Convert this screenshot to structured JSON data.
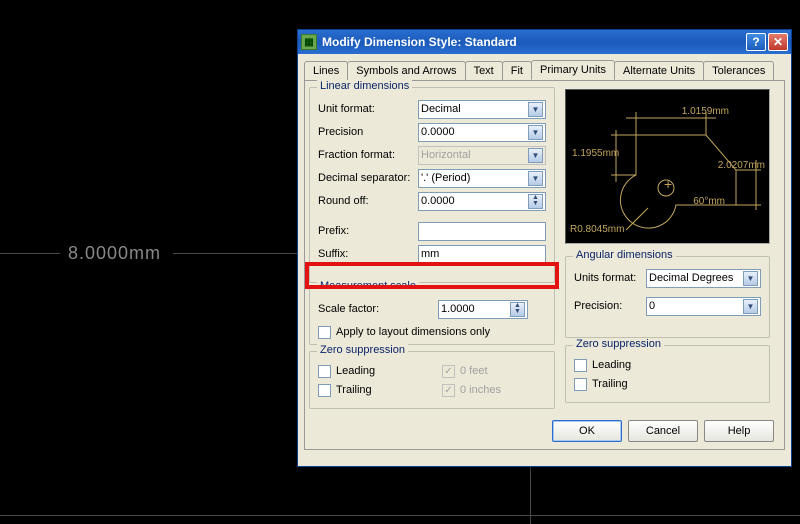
{
  "background": {
    "dimension_text": "8.0000mm"
  },
  "dialog": {
    "title": "Modify Dimension Style: Standard",
    "tabs": {
      "lines": "Lines",
      "symbols_arrows": "Symbols and Arrows",
      "text": "Text",
      "fit": "Fit",
      "primary_units": "Primary Units",
      "alternate_units": "Alternate Units",
      "tolerances": "Tolerances"
    },
    "linear": {
      "legend": "Linear dimensions",
      "unit_format_label": "Unit format:",
      "unit_format_value": "Decimal",
      "precision_label": "Precision",
      "precision_value": "0.0000",
      "fraction_format_label": "Fraction format:",
      "fraction_format_value": "Horizontal",
      "decimal_sep_label": "Decimal separator:",
      "decimal_sep_value": "'.' (Period)",
      "round_label": "Round off:",
      "round_value": "0.0000",
      "prefix_label": "Prefix:",
      "prefix_value": "",
      "suffix_label": "Suffix:",
      "suffix_value": "mm"
    },
    "scale": {
      "legend": "Measurement scale",
      "factor_label": "Scale factor:",
      "factor_value": "1.0000",
      "apply_layout_label": "Apply to layout dimensions only"
    },
    "zero_linear": {
      "legend": "Zero suppression",
      "leading": "Leading",
      "trailing": "Trailing",
      "feet": "0 feet",
      "inches": "0 inches"
    },
    "angular": {
      "legend": "Angular dimensions",
      "units_format_label": "Units format:",
      "units_format_value": "Decimal Degrees",
      "precision_label": "Precision:",
      "precision_value": "0"
    },
    "zero_angular": {
      "legend": "Zero suppression",
      "leading": "Leading",
      "trailing": "Trailing"
    },
    "preview": {
      "d1": "1.0159mm",
      "d2": "2.0207mm",
      "d3": "1.1955mm",
      "r": "R0.8045mm",
      "ang": "60°mm"
    },
    "buttons": {
      "ok": "OK",
      "cancel": "Cancel",
      "help": "Help"
    }
  }
}
